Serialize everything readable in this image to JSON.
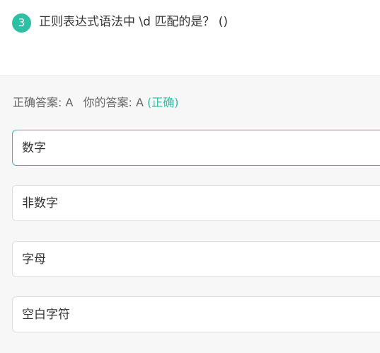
{
  "question": {
    "number": "3",
    "text": "正则表达式语法中 \\d 匹配的是？ ()"
  },
  "answer": {
    "correct_label": "正确答案:",
    "correct_value": "A",
    "yours_label": "你的答案:",
    "yours_value": "A",
    "result": "(正确)"
  },
  "options": [
    {
      "label": "数字",
      "selected": true
    },
    {
      "label": "非数字",
      "selected": false
    },
    {
      "label": "字母",
      "selected": false
    },
    {
      "label": "空白字符",
      "selected": false
    }
  ],
  "colors": {
    "accent": "#2ebfa5",
    "background": "#f7f7f7",
    "card": "#ffffff",
    "border": "#dddddd"
  }
}
